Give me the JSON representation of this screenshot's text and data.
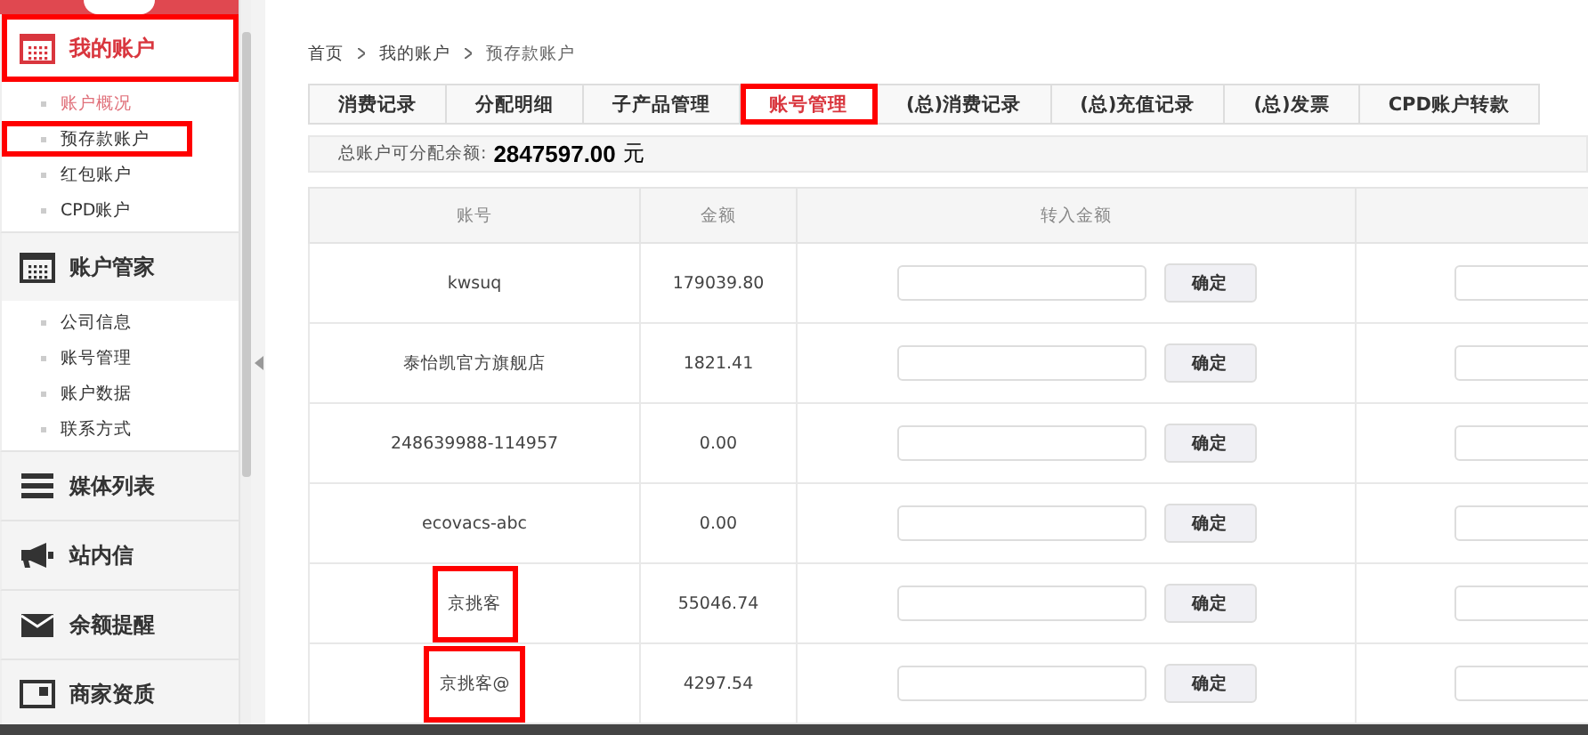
{
  "sidebar": {
    "groups": [
      {
        "title": "我的账户",
        "active": true,
        "highlighted": true,
        "items": [
          {
            "label": "账户概况",
            "selected": true,
            "highlighted": false
          },
          {
            "label": "预存款账户",
            "selected": false,
            "highlighted": true
          },
          {
            "label": "红包账户",
            "selected": false,
            "highlighted": false
          },
          {
            "label": "CPD账户",
            "selected": false,
            "highlighted": false
          }
        ]
      },
      {
        "title": "账户管家",
        "active": false,
        "highlighted": false,
        "items": [
          {
            "label": "公司信息",
            "selected": false,
            "highlighted": false
          },
          {
            "label": "账号管理",
            "selected": false,
            "highlighted": false
          },
          {
            "label": "账户数据",
            "selected": false,
            "highlighted": false
          },
          {
            "label": "联系方式",
            "selected": false,
            "highlighted": false
          }
        ]
      },
      {
        "title": "媒体列表",
        "active": false,
        "highlighted": false
      },
      {
        "title": "站内信",
        "active": false,
        "highlighted": false
      },
      {
        "title": "余额提醒",
        "active": false,
        "highlighted": false
      },
      {
        "title": "商家资质",
        "active": false,
        "highlighted": false
      }
    ]
  },
  "breadcrumb": [
    "首页",
    "我的账户",
    "预存款账户"
  ],
  "tabs": [
    {
      "label": "消费记录",
      "selected": false,
      "highlighted": false
    },
    {
      "label": "分配明细",
      "selected": false,
      "highlighted": false
    },
    {
      "label": "子产品管理",
      "selected": false,
      "highlighted": false
    },
    {
      "label": "账号管理",
      "selected": true,
      "highlighted": true
    },
    {
      "label": "(总)消费记录",
      "selected": false,
      "highlighted": false
    },
    {
      "label": "(总)充值记录",
      "selected": false,
      "highlighted": false
    },
    {
      "label": "(总)发票",
      "selected": false,
      "highlighted": false
    },
    {
      "label": "CPD账户转款",
      "selected": false,
      "highlighted": false
    }
  ],
  "summary": {
    "label": "总账户可分配余额:",
    "amount": "2847597.00",
    "unit": "元"
  },
  "table": {
    "columns": [
      "账号",
      "金额",
      "转入金额"
    ],
    "rows": [
      {
        "account": "kwsuq",
        "amount": "179039.80",
        "button": "确定",
        "highlighted": false
      },
      {
        "account": "泰怡凯官方旗舰店",
        "amount": "1821.41",
        "button": "确定",
        "highlighted": false
      },
      {
        "account": "248639988-114957",
        "amount": "0.00",
        "button": "确定",
        "highlighted": false
      },
      {
        "account": "ecovacs-abc",
        "amount": "0.00",
        "button": "确定",
        "highlighted": false
      },
      {
        "account": "京挑客",
        "amount": "55046.74",
        "button": "确定",
        "highlighted": true
      },
      {
        "account": "京挑客@",
        "amount": "4297.54",
        "button": "确定",
        "highlighted": true
      }
    ]
  }
}
